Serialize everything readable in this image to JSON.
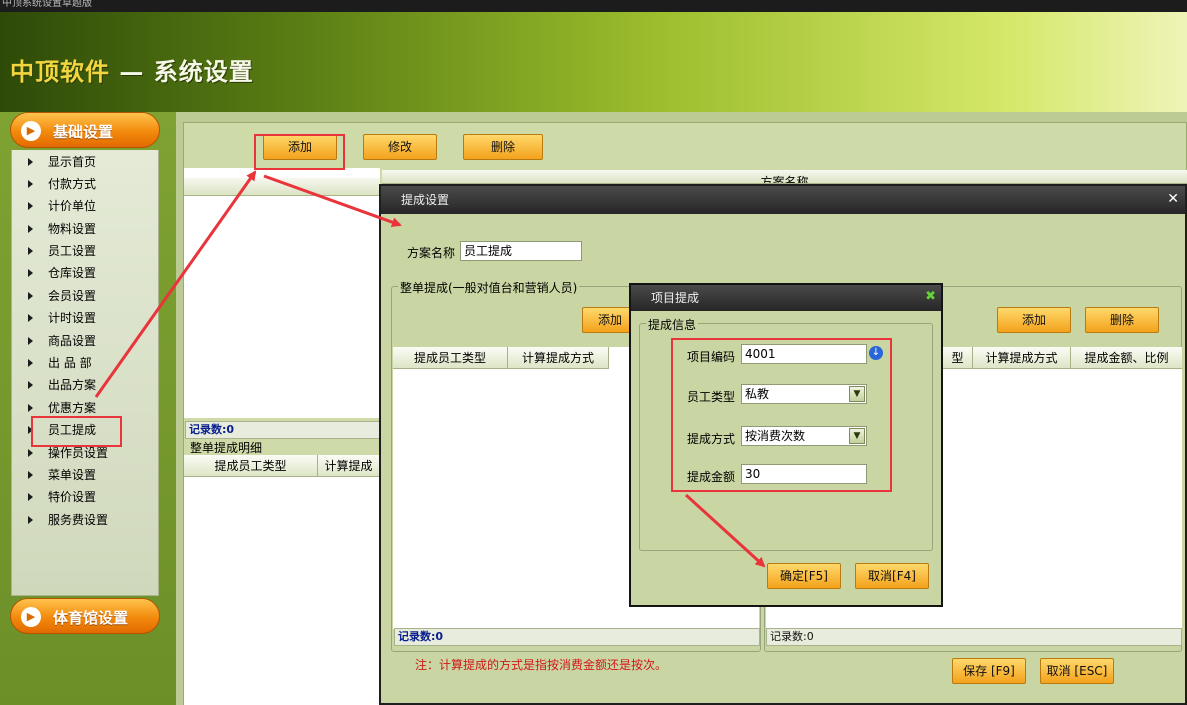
{
  "window": {
    "title": "中顶系统设置草题版"
  },
  "brand": {
    "company": "中顶软件",
    "separator": " — ",
    "page": "系统设置"
  },
  "sidebar": {
    "section_basic": "基础设置",
    "section_gym": "体育馆设置",
    "items": [
      "显示首页",
      "付款方式",
      "计价单位",
      "物料设置",
      "员工设置",
      "仓库设置",
      "会员设置",
      "计时设置",
      "商品设置",
      "出 品 部",
      "出品方案",
      "优惠方案",
      "员工提成",
      "操作员设置",
      "菜单设置",
      "特价设置",
      "服务费设置"
    ]
  },
  "toolbar": {
    "add": "添加",
    "edit": "修改",
    "delete": "删除"
  },
  "main": {
    "grid_header": "方案名称",
    "record_count": "记录数:0",
    "detail_title": "整单提成明细",
    "detail_columns": [
      "提成员工类型",
      "计算提成"
    ]
  },
  "dialog": {
    "title": "提成设置",
    "scheme_label": "方案名称",
    "scheme_value": "员工提成",
    "group_left": "整单提成(一般对值台和营销人员)",
    "left_add": "添加",
    "left_columns": [
      "提成员工类型",
      "计算提成方式"
    ],
    "left_count": "记录数:0",
    "right_add": "添加",
    "right_delete": "删除",
    "right_columns": [
      "型",
      "计算提成方式",
      "提成金额、比例"
    ],
    "right_count": "记录数:0",
    "note": "注：计算提成的方式是指按消费金额还是按次。",
    "save": "保存 [F9]",
    "cancel": "取消 [ESC]"
  },
  "subdialog": {
    "title": "项目提成",
    "group": "提成信息",
    "code_label": "项目编码",
    "code_value": "4001",
    "staff_type_label": "员工类型",
    "staff_type_value": "私教",
    "method_label": "提成方式",
    "method_value": "按消费次数",
    "amount_label": "提成金额",
    "amount_value": "30",
    "ok": "确定[F5]",
    "cancel": "取消[F4]"
  },
  "colors": {
    "highlight": "#e8343a",
    "button": "#f3a21c",
    "panel": "#c9d6a3"
  }
}
